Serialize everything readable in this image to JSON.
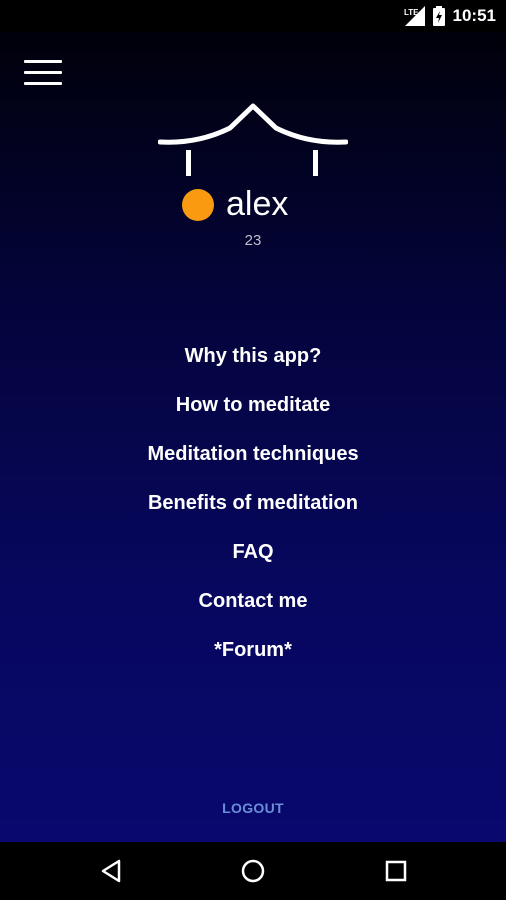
{
  "status_bar": {
    "network": "LTE",
    "time": "10:51",
    "icons": [
      "signal-icon",
      "battery-icon"
    ]
  },
  "header": {
    "menu_icon": "hamburger-menu-icon",
    "logo_icon": "pagoda-roof-logo"
  },
  "profile": {
    "name": "alex",
    "age": "23",
    "avatar_color": "#f99a10"
  },
  "menu": {
    "items": [
      {
        "label": "Why this app?"
      },
      {
        "label": "How to meditate"
      },
      {
        "label": "Meditation techniques"
      },
      {
        "label": "Benefits of meditation"
      },
      {
        "label": "FAQ"
      },
      {
        "label": "Contact me"
      },
      {
        "label": "*Forum*"
      }
    ]
  },
  "logout": {
    "label": "LOGOUT",
    "color": "#6a8fd6"
  },
  "nav_bar": {
    "buttons": [
      "back-icon",
      "home-icon",
      "recents-icon"
    ]
  },
  "theme": {
    "background_top": "#000005",
    "background_bottom": "#08086e",
    "text": "#ffffff"
  }
}
